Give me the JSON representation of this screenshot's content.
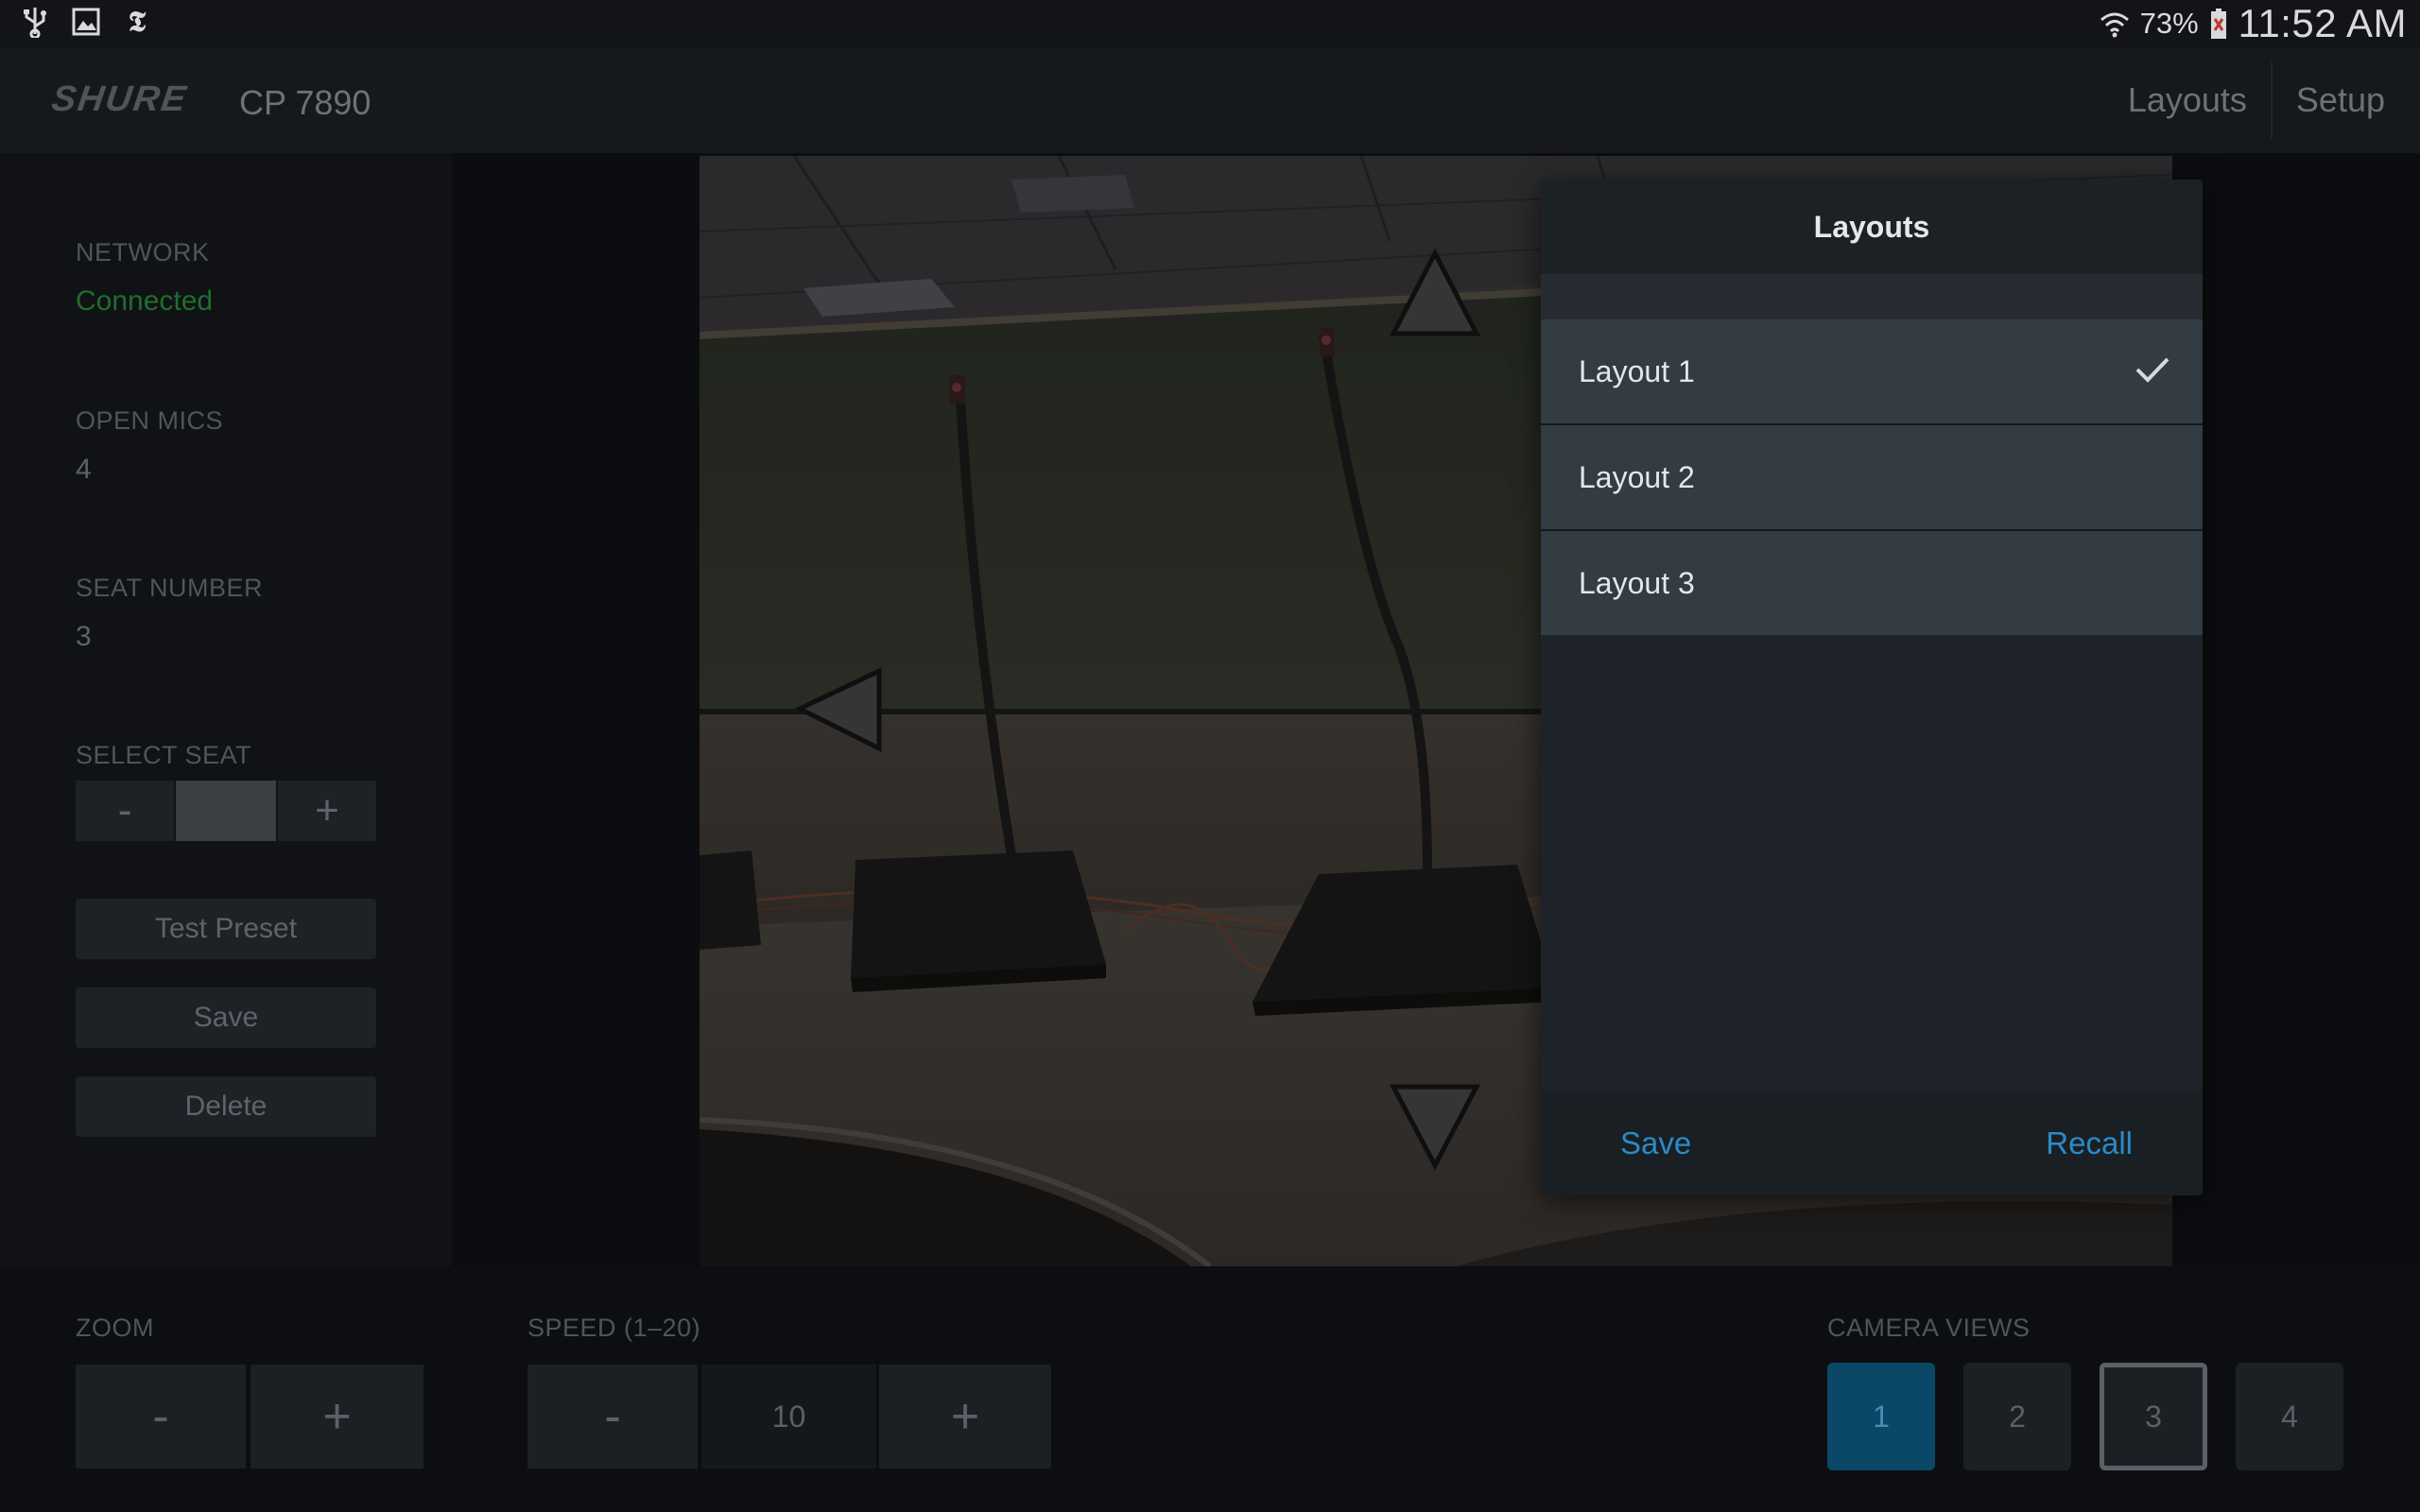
{
  "status_bar": {
    "icons_left": [
      "usb-icon",
      "image-icon",
      "nytimes-icon"
    ],
    "wifi_icon": "wifi-icon",
    "battery_percent": "73%",
    "battery_icon": "battery-icon",
    "time": "11:52 AM"
  },
  "header": {
    "brand": "SHURE",
    "model": "CP 7890",
    "nav": [
      "Layouts",
      "Setup"
    ]
  },
  "sidebar": {
    "network_label": "NETWORK",
    "network_value": "Connected",
    "open_mics_label": "OPEN MICS",
    "open_mics_value": "4",
    "seat_number_label": "SEAT NUMBER",
    "seat_number_value": "3",
    "select_seat_label": "SELECT SEAT",
    "minus": "-",
    "plus": "+",
    "buttons": {
      "test_preset": "Test Preset",
      "save": "Save",
      "delete": "Delete"
    }
  },
  "bottom": {
    "zoom_label": "ZOOM",
    "speed_label": "SPEED (1–20)",
    "speed_value": "10",
    "minus": "-",
    "plus": "+",
    "camera_views_label": "CAMERA VIEWS",
    "camera_views": [
      "1",
      "2",
      "3",
      "4"
    ]
  },
  "popup": {
    "title": "Layouts",
    "items": [
      "Layout 1",
      "Layout 2",
      "Layout 3"
    ],
    "selected_index": 0,
    "save": "Save",
    "recall": "Recall"
  },
  "colors": {
    "accent_blue": "#2a8bc8",
    "connected_green": "#1f6e2b",
    "active_camera": "#0b4868"
  }
}
